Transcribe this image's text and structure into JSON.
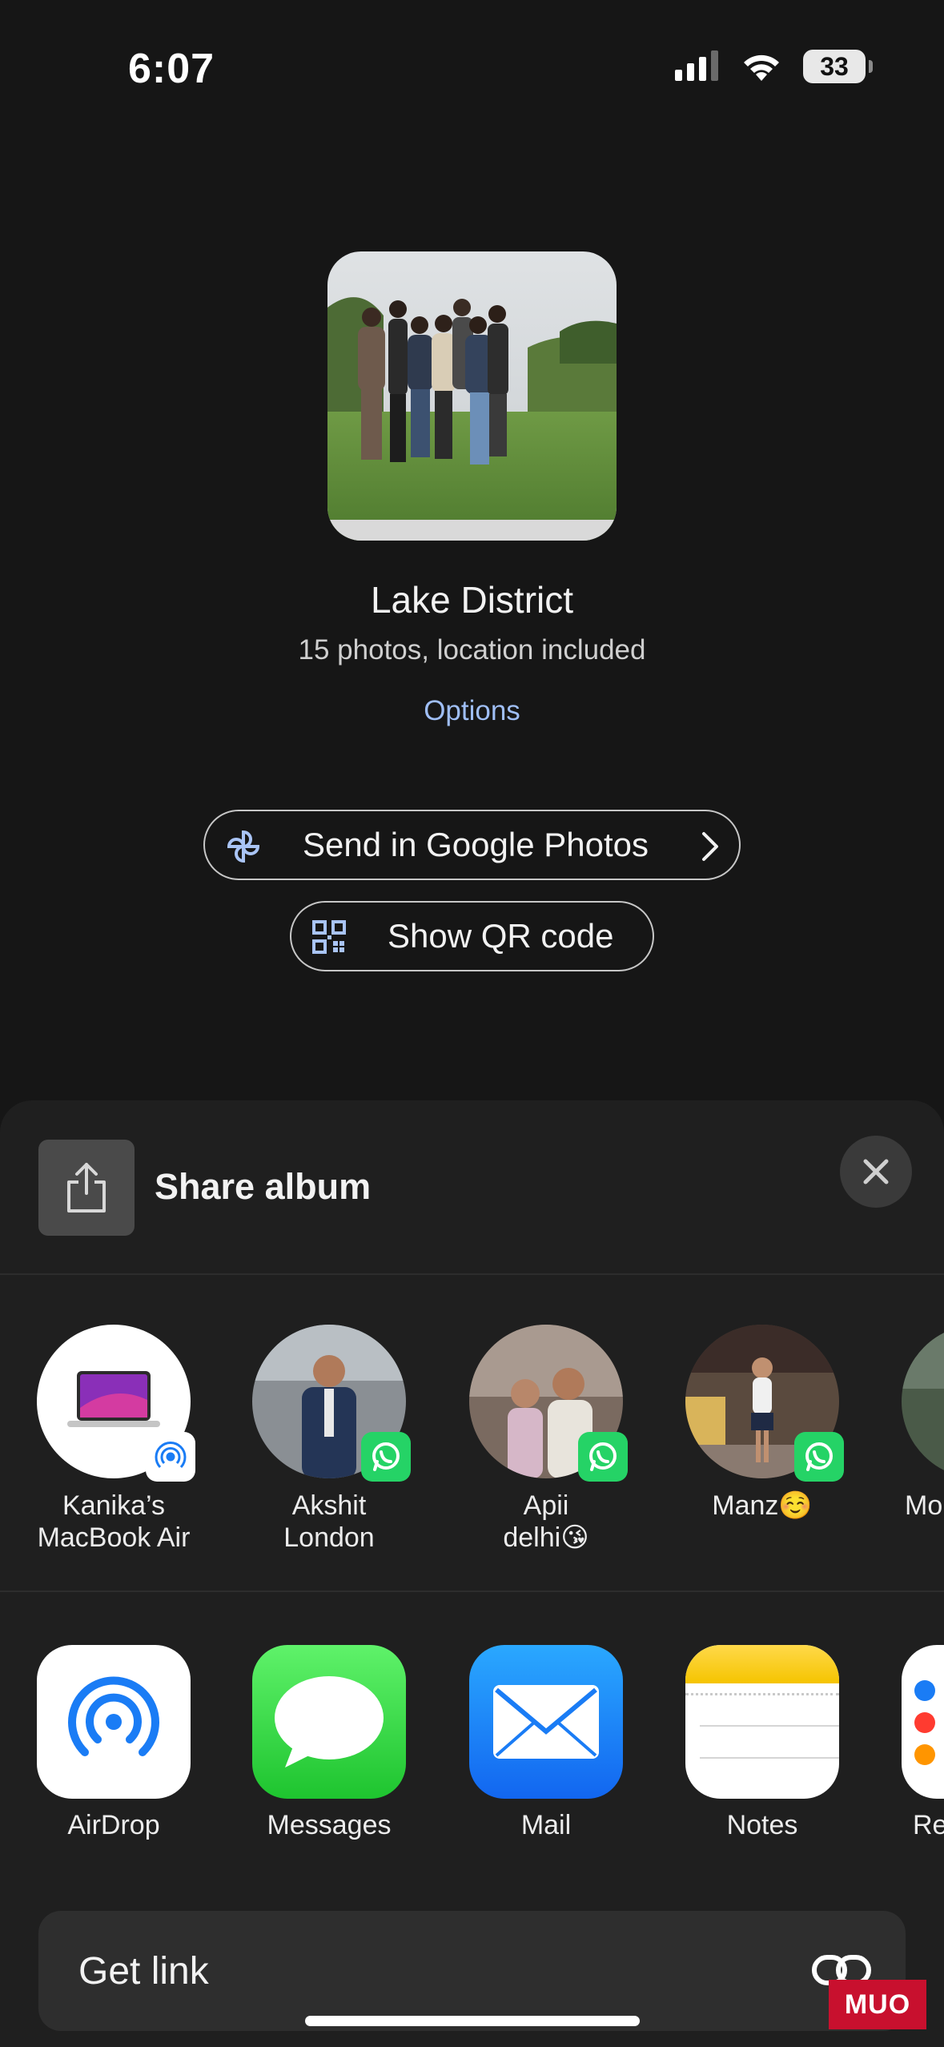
{
  "status_bar": {
    "time": "6:07",
    "battery": "33"
  },
  "album": {
    "title": "Lake District",
    "subtitle": "15 photos, location included",
    "options_label": "Options",
    "send_label": "Send in Google Photos",
    "qr_label": "Show QR code"
  },
  "share_sheet": {
    "title": "Share album",
    "people": [
      {
        "name": "Kanika’s\nMacBook Air",
        "badge": "airdrop-icon"
      },
      {
        "name": "Akshit\nLondon",
        "badge": "whatsapp-icon"
      },
      {
        "name": "Apii\ndelhi😘",
        "badge": "whatsapp-icon"
      },
      {
        "name": "Manz☺️",
        "badge": "whatsapp-icon"
      },
      {
        "name": "Mo",
        "badge": "whatsapp-icon"
      }
    ],
    "apps": [
      {
        "label": "AirDrop",
        "icon": "airdrop-icon"
      },
      {
        "label": "Messages",
        "icon": "messages-icon"
      },
      {
        "label": "Mail",
        "icon": "mail-icon"
      },
      {
        "label": "Notes",
        "icon": "notes-icon"
      },
      {
        "label": "Re",
        "icon": "reminders-icon"
      }
    ],
    "get_link_label": "Get link"
  },
  "watermark": "MUO",
  "colors": {
    "accent_blue": "#9fbef5",
    "whatsapp_green": "#25d366",
    "background": "#161616",
    "sheet": "#1f1f1f"
  }
}
